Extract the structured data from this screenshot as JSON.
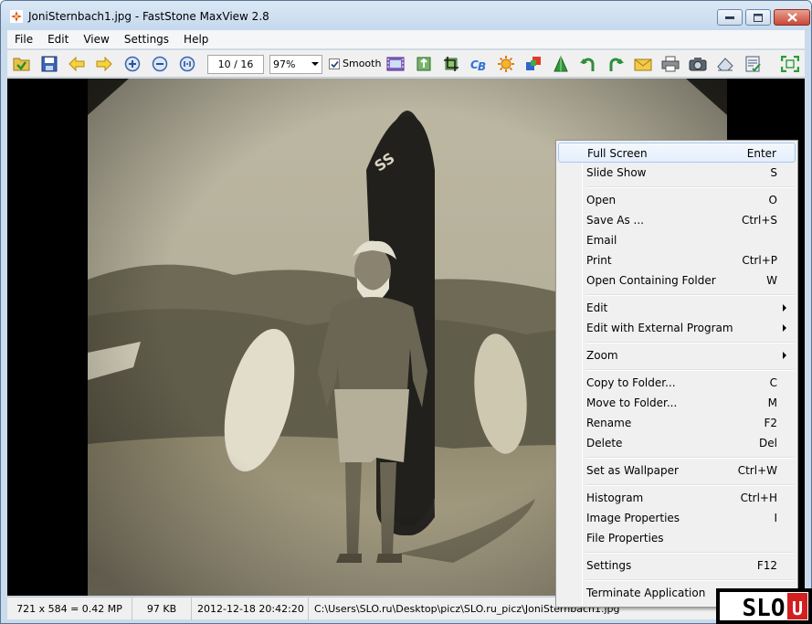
{
  "window": {
    "title": "JoniSternbach1.jpg - FastStone MaxView 2.8"
  },
  "menubar": {
    "items": [
      "File",
      "Edit",
      "View",
      "Settings",
      "Help"
    ]
  },
  "toolbar": {
    "page_counter": "10 / 16",
    "zoom_value": "97%",
    "smooth_label": "Smooth",
    "smooth_checked": true,
    "icons": [
      "open-folder-icon",
      "save-icon",
      "previous-arrow-icon",
      "next-arrow-icon",
      "zoom-in-icon",
      "zoom-out-icon",
      "actual-size-icon",
      "slideshow-icon",
      "copy-to-folder-icon",
      "crop-icon",
      "color-balance-icon",
      "brightness-icon",
      "colors-icon",
      "sharpen-icon",
      "rotate-left-icon",
      "rotate-right-icon",
      "email-icon",
      "print-icon",
      "camera-icon",
      "eraser-icon",
      "properties-icon",
      "fit-window-icon"
    ]
  },
  "statusbar": {
    "dimensions": "721 x 584 = 0.42 MP",
    "filesize": "97 KB",
    "datetime": "2012-12-18 20:42:20",
    "path": "C:\\Users\\SLO.ru\\Desktop\\picz\\SLO.ru_picz\\JoniSternbach1.jpg"
  },
  "context_menu": {
    "items": [
      {
        "label": "Full Screen",
        "shortcut": "Enter",
        "highlighted": true
      },
      {
        "label": "Slide Show",
        "shortcut": "S"
      },
      {
        "label": "Open",
        "shortcut": "O"
      },
      {
        "label": "Save As ...",
        "shortcut": "Ctrl+S"
      },
      {
        "label": "Email",
        "shortcut": ""
      },
      {
        "label": "Print",
        "shortcut": "Ctrl+P"
      },
      {
        "label": "Open Containing Folder",
        "shortcut": "W"
      },
      {
        "label": "Edit",
        "shortcut": "",
        "submenu": true
      },
      {
        "label": "Edit with External Program",
        "shortcut": "",
        "submenu": true
      },
      {
        "label": "Zoom",
        "shortcut": "",
        "submenu": true
      },
      {
        "label": "Copy to Folder...",
        "shortcut": "C"
      },
      {
        "label": "Move to Folder...",
        "shortcut": "M"
      },
      {
        "label": "Rename",
        "shortcut": "F2"
      },
      {
        "label": "Delete",
        "shortcut": "Del"
      },
      {
        "label": "Set as Wallpaper",
        "shortcut": "Ctrl+W"
      },
      {
        "label": "Histogram",
        "shortcut": "Ctrl+H"
      },
      {
        "label": "Image Properties",
        "shortcut": "I"
      },
      {
        "label": "File Properties",
        "shortcut": ""
      },
      {
        "label": "Settings",
        "shortcut": "F12"
      },
      {
        "label": "Terminate Application",
        "shortcut": ""
      }
    ]
  },
  "watermark": {
    "text": "SLO.RU"
  },
  "colors": {
    "photo_sepia": "#a39c84",
    "viewer_bg": "#000000",
    "highlight_border": "#a8c8ec"
  }
}
